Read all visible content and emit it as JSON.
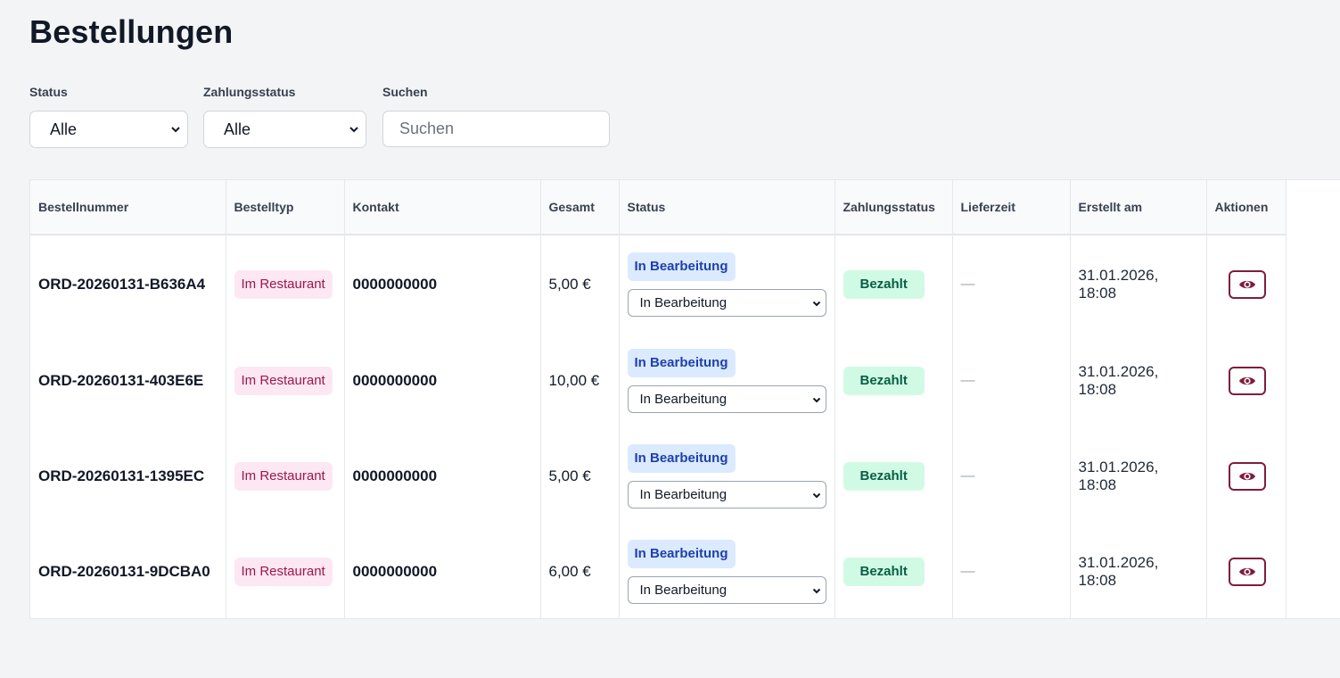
{
  "page": {
    "title": "Bestellungen"
  },
  "filters": {
    "status": {
      "label": "Status",
      "value": "Alle"
    },
    "payment": {
      "label": "Zahlungsstatus",
      "value": "Alle"
    },
    "search": {
      "label": "Suchen",
      "placeholder": "Suchen"
    }
  },
  "table": {
    "headers": [
      "Bestellnummer",
      "Bestelltyp",
      "Kontakt",
      "Gesamt",
      "Status",
      "Zahlungsstatus",
      "Lieferzeit",
      "Erstellt am",
      "Aktionen"
    ],
    "rows": [
      {
        "order_no": "ORD-20260131-B636A4",
        "type": "Im Restaurant",
        "contact": "0000000000",
        "total": "5,00 €",
        "status_badge": "In Bearbeitung",
        "status_select": "In Bearbeitung",
        "payment": "Bezahlt",
        "delivery": "—",
        "created": "31.01.2026, 18:08"
      },
      {
        "order_no": "ORD-20260131-403E6E",
        "type": "Im Restaurant",
        "contact": "0000000000",
        "total": "10,00 €",
        "status_badge": "In Bearbeitung",
        "status_select": "In Bearbeitung",
        "payment": "Bezahlt",
        "delivery": "—",
        "created": "31.01.2026, 18:08"
      },
      {
        "order_no": "ORD-20260131-1395EC",
        "type": "Im Restaurant",
        "contact": "0000000000",
        "total": "5,00 €",
        "status_badge": "In Bearbeitung",
        "status_select": "In Bearbeitung",
        "payment": "Bezahlt",
        "delivery": "—",
        "created": "31.01.2026, 18:08"
      },
      {
        "order_no": "ORD-20260131-9DCBA0",
        "type": "Im Restaurant",
        "contact": "0000000000",
        "total": "6,00 €",
        "status_badge": "In Bearbeitung",
        "status_select": "In Bearbeitung",
        "payment": "Bezahlt",
        "delivery": "—",
        "created": "31.01.2026, 18:08"
      }
    ]
  },
  "icons": {
    "view": "eye-icon",
    "dropdown": "chevron-down-icon"
  },
  "colors": {
    "accent": "#7f1d3a",
    "type_bg": "#fce7f3",
    "status_bg": "#dbeafe",
    "paid_bg": "#d1fae5"
  }
}
